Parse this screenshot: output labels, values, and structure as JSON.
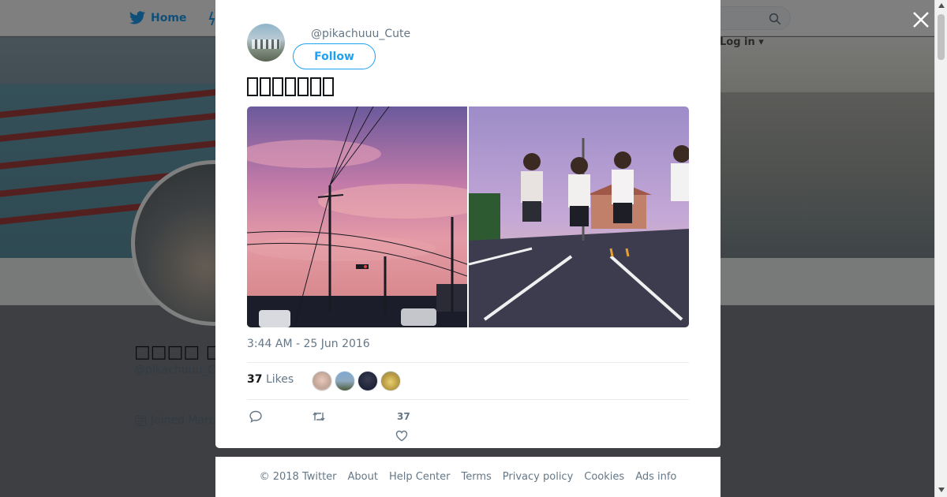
{
  "background": {
    "nav": {
      "home_label": "Home",
      "login_label": "Log in"
    },
    "profile": {
      "display_name": "□□□□ □□□",
      "handle": "@pikachuuu_C",
      "joined": "Joined March"
    }
  },
  "tweet": {
    "handle": "@pikachuuu_Cute",
    "follow_label": "Follow",
    "text_glyph_count": 7,
    "timestamp": "3:44 AM - 25 Jun 2016",
    "likes_count": "37",
    "likes_label": "Likes",
    "like_action_count": "37"
  },
  "footer": {
    "links": [
      "© 2018 Twitter",
      "About",
      "Help Center",
      "Terms",
      "Privacy policy",
      "Cookies",
      "Ads info"
    ]
  },
  "colors": {
    "accent": "#1da1f2",
    "muted": "#657786",
    "text": "#14171a"
  },
  "icons": [
    "twitter-bird-icon",
    "search-icon",
    "close-icon",
    "calendar-icon",
    "reply-icon",
    "retweet-icon",
    "heart-icon"
  ]
}
